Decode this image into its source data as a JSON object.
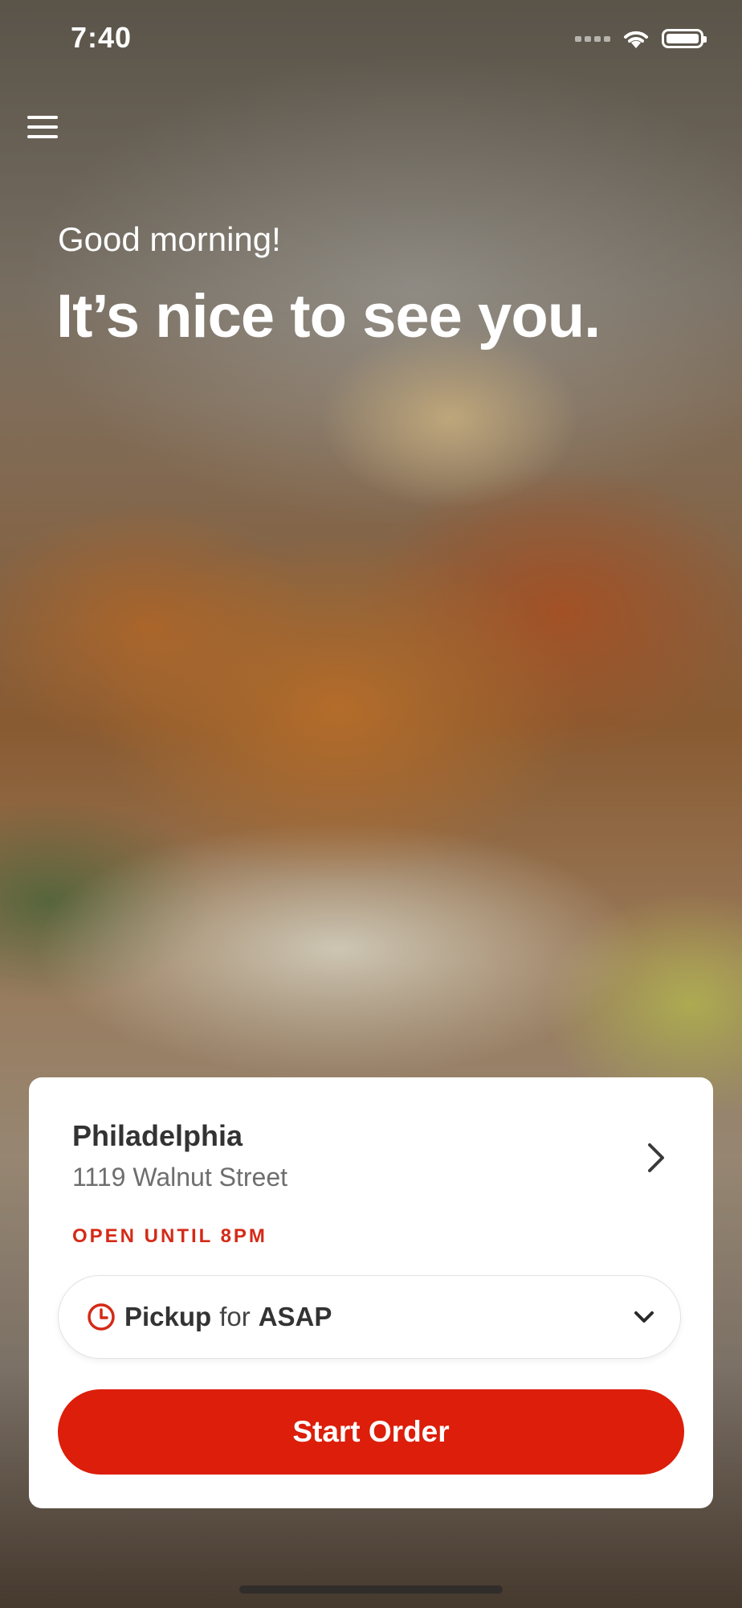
{
  "status_bar": {
    "time": "7:40"
  },
  "header": {
    "menu_icon": "hamburger-menu-icon"
  },
  "hero": {
    "greeting": "Good morning!",
    "headline": "It’s nice to see you."
  },
  "location_card": {
    "city": "Philadelphia",
    "address": "1119 Walnut Street",
    "open_status": "OPEN UNTIL 8PM",
    "chevron_icon": "chevron-right-icon",
    "pickup": {
      "clock_icon": "clock-icon",
      "mode": "Pickup",
      "connector": "for",
      "time": "ASAP",
      "dropdown_icon": "chevron-down-icon"
    },
    "start_order_label": "Start Order"
  },
  "colors": {
    "accent": "#dc1e0a",
    "open_status": "#d42a17"
  }
}
